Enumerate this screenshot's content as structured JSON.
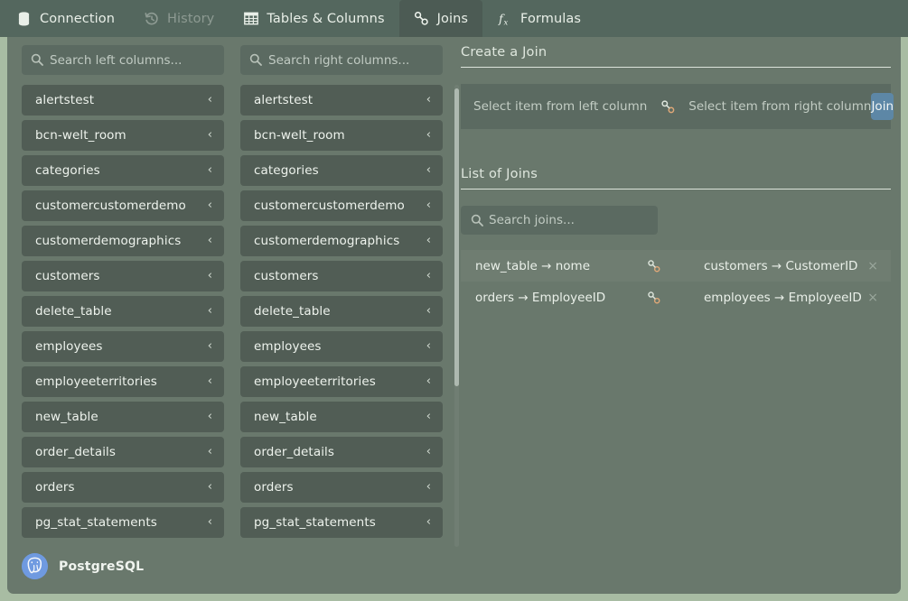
{
  "tabs": [
    {
      "label": "Connection",
      "icon": "database-icon",
      "state": "inactive"
    },
    {
      "label": "History",
      "icon": "history-icon",
      "state": "disabled"
    },
    {
      "label": "Tables & Columns",
      "icon": "table-grid-icon",
      "state": "inactive"
    },
    {
      "label": "Joins",
      "icon": "link-icon",
      "state": "active"
    },
    {
      "label": "Formulas",
      "icon": "function-icon",
      "state": "inactive"
    }
  ],
  "left_column": {
    "search_placeholder": "Search left columns...",
    "items": [
      "alertstest",
      "bcn-welt_room",
      "categories",
      "customercustomerdemo",
      "customerdemographics",
      "customers",
      "delete_table",
      "employees",
      "employeeterritories",
      "new_table",
      "order_details",
      "orders",
      "pg_stat_statements"
    ]
  },
  "right_column": {
    "search_placeholder": "Search right columns...",
    "items": [
      "alertstest",
      "bcn-welt_room",
      "categories",
      "customercustomerdemo",
      "customerdemographics",
      "customers",
      "delete_table",
      "employees",
      "employeeterritories",
      "new_table",
      "order_details",
      "orders",
      "pg_stat_statements"
    ]
  },
  "create_join": {
    "title": "Create a Join",
    "left_placeholder": "Select item from left column",
    "right_placeholder": "Select item from right column",
    "button_label": "Join",
    "button_color": "#5d87a6"
  },
  "list_of_joins": {
    "title": "List of Joins",
    "search_placeholder": "Search joins...",
    "rows": [
      {
        "left": "new_table → nome",
        "right": "customers → CustomerID",
        "remove": "×",
        "highlighted": true
      },
      {
        "left": "orders → EmployeeID",
        "right": "employees → EmployeeID",
        "remove": "×",
        "highlighted": false
      }
    ]
  },
  "footer": {
    "database_name": "PostgreSQL",
    "logo": "postgresql-elephant-icon"
  },
  "theme": {
    "window_bg": "#a8bca3",
    "tabbar_bg": "#54675e",
    "panel_bg": "#69786c",
    "item_bg": "#515d55",
    "field_bg": "#5b6a61",
    "text": "#eef3ed"
  },
  "chevron": "‹"
}
